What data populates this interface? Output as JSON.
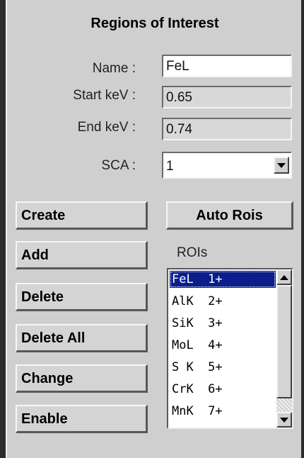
{
  "title": "Regions of Interest",
  "form": {
    "name_label": "Name :",
    "name_value": "FeL",
    "start_label": "Start keV :",
    "start_value": "0.65",
    "end_label": "End keV :",
    "end_value": "0.74",
    "sca_label": "SCA :",
    "sca_value": "1"
  },
  "buttons": {
    "create": "Create",
    "auto_rois": "Auto Rois",
    "add": "Add",
    "delete": "Delete",
    "delete_all": "Delete All",
    "change": "Change",
    "enable": "Enable"
  },
  "rois_label": "ROIs",
  "rois": [
    {
      "text": "FeL  1+",
      "selected": true
    },
    {
      "text": "AlK  2+",
      "selected": false
    },
    {
      "text": "SiK  3+",
      "selected": false
    },
    {
      "text": "MoL  4+",
      "selected": false
    },
    {
      "text": "S K  5+",
      "selected": false
    },
    {
      "text": "CrK  6+",
      "selected": false
    },
    {
      "text": "MnK  7+",
      "selected": false
    }
  ],
  "colors": {
    "selection": "#0b1e8c",
    "panel": "#cfcfcf"
  }
}
